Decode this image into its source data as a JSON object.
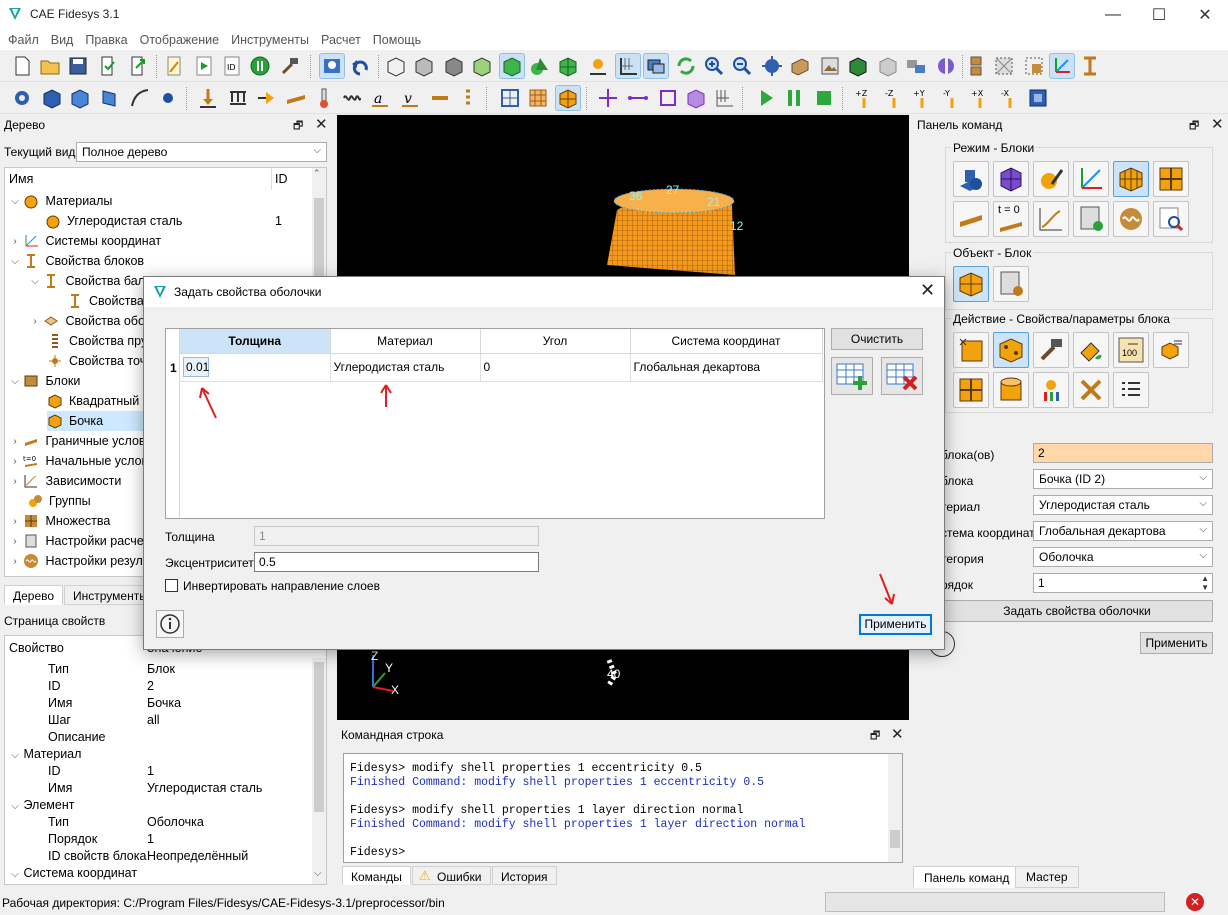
{
  "window": {
    "title": "CAE Fidesys 3.1",
    "minimize": "—",
    "maximize": "☐",
    "close": "✕"
  },
  "menu": [
    "Файл",
    "Вид",
    "Правка",
    "Отображение",
    "Инструменты",
    "Расчет",
    "Помощь"
  ],
  "tree_panel": {
    "title": "Дерево",
    "view_label": "Текущий вид",
    "view_value": "Полное дерево",
    "col_name": "Имя",
    "col_id": "ID",
    "items": [
      {
        "label": "Материалы",
        "id": ""
      },
      {
        "label": "Углеродистая сталь",
        "id": "1"
      },
      {
        "label": "Системы координат",
        "id": ""
      },
      {
        "label": "Свойства блоков",
        "id": ""
      },
      {
        "label": "Свойства бал",
        "id": ""
      },
      {
        "label": "Свойства",
        "id": ""
      },
      {
        "label": "Свойства обо",
        "id": ""
      },
      {
        "label": "Свойства пру",
        "id": ""
      },
      {
        "label": "Свойства точ",
        "id": ""
      },
      {
        "label": "Блоки",
        "id": ""
      },
      {
        "label": "Квадратный г",
        "id": ""
      },
      {
        "label": "Бочка",
        "id": ""
      },
      {
        "label": "Граничные услов",
        "id": ""
      },
      {
        "label": "Начальные услов",
        "id": ""
      },
      {
        "label": "Зависимости",
        "id": ""
      },
      {
        "label": "Группы",
        "id": ""
      },
      {
        "label": "Множества",
        "id": ""
      },
      {
        "label": "Настройки расче",
        "id": ""
      },
      {
        "label": "Настройки резул",
        "id": ""
      }
    ],
    "tabs": [
      "Дерево",
      "Инструменты"
    ]
  },
  "props_panel": {
    "title": "Страница свойств",
    "col_prop": "Свойство",
    "col_value": "Значение",
    "rows": [
      {
        "k": "Тип",
        "v": "Блок"
      },
      {
        "k": "ID",
        "v": "2"
      },
      {
        "k": "Имя",
        "v": "Бочка"
      },
      {
        "k": "Шаг",
        "v": "all"
      },
      {
        "k": "Описание",
        "v": ""
      },
      {
        "k": "Материал",
        "v": ""
      },
      {
        "k": "ID",
        "v": "1"
      },
      {
        "k": "Имя",
        "v": "Углеродистая сталь"
      },
      {
        "k": "Элемент",
        "v": ""
      },
      {
        "k": "Тип",
        "v": "Оболочка"
      },
      {
        "k": "Порядок",
        "v": "1"
      },
      {
        "k": "ID свойств блока",
        "v": "Неопределённый"
      },
      {
        "k": "Система координат",
        "v": ""
      }
    ]
  },
  "viewport": {
    "node_labels": [
      "36",
      "27",
      "21",
      "12",
      "40"
    ],
    "axes": {
      "z": "Z",
      "y": "Y",
      "x": "X"
    }
  },
  "command_line": {
    "title": "Командная строка",
    "lines": [
      {
        "text": "Fidesys> modify shell properties 1 eccentricity 0.5",
        "kind": "cmd"
      },
      {
        "text": "Finished Command: modify shell properties 1 eccentricity 0.5",
        "kind": "done"
      },
      {
        "text": "",
        "kind": "blank"
      },
      {
        "text": "Fidesys> modify shell properties 1 layer direction normal",
        "kind": "cmd"
      },
      {
        "text": "Finished Command: modify shell properties 1 layer direction normal",
        "kind": "done"
      },
      {
        "text": "",
        "kind": "blank"
      },
      {
        "text": "Fidesys>",
        "kind": "cmd"
      }
    ],
    "tabs": [
      "Команды",
      "Ошибки",
      "История"
    ]
  },
  "command_panel": {
    "title": "Панель команд",
    "group_mode": "Режим - Блоки",
    "group_object": "Объект - Блок",
    "group_action": "Действие - Свойства/параметры блока",
    "t0_label": "t = 0",
    "counter_label": "100",
    "form": {
      "blocks_label": "блока(ов)",
      "blocks_value": "2",
      "block_label": "блока",
      "block_value": "Бочка (ID 2)",
      "material_label": "териал",
      "material_value": "Углеродистая сталь",
      "cs_label": "стема координат",
      "cs_value": "Глобальная декартова",
      "category_label": "тегория",
      "category_value": "Оболочка",
      "order_label": "рядок",
      "order_value": "1",
      "shell_button": "Задать свойства оболочки",
      "apply_button": "Применить"
    },
    "tabs": [
      "Панель команд",
      "Мастер"
    ]
  },
  "dialog": {
    "title": "Задать свойства оболочки",
    "columns": [
      "Толщина",
      "Материал",
      "Угол",
      "Система координат"
    ],
    "row": {
      "num": "1",
      "thickness": "0.01",
      "material": "Углеродистая сталь",
      "angle": "0",
      "cs": "Глобальная декартова"
    },
    "clear_button": "Очистить",
    "thickness_label": "Толщина",
    "thickness_value": "1",
    "eccentricity_label": "Эксцентриситет",
    "eccentricity_value": "0.5",
    "invert_label": "Инвертировать направление слоев",
    "apply_button": "Применить"
  },
  "status": {
    "workdir": "Рабочая директория: C:/Program Files/Fidesys/CAE-Fidesys-3.1/preprocessor/bin"
  },
  "colors": {
    "accent": "#0078d7",
    "orange_field": "#ffd7a8",
    "mesh_orange": "#f39a1e",
    "arrow_red": "#e02020",
    "cmd_blue": "#1a2fbf"
  }
}
